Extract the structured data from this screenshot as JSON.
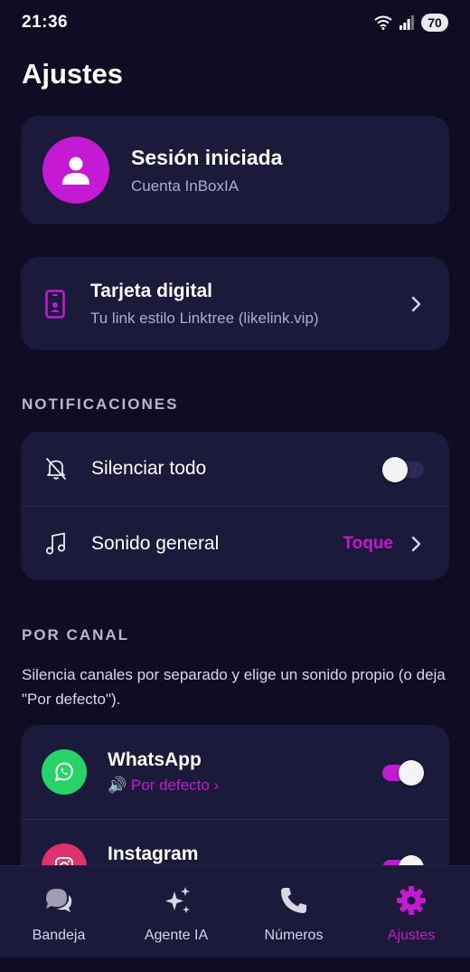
{
  "status_bar": {
    "time": "21:36",
    "battery": "70"
  },
  "page_title": "Ajustes",
  "profile": {
    "title": "Sesión iniciada",
    "subtitle": "Cuenta InBoxIA"
  },
  "digital_card": {
    "title": "Tarjeta digital",
    "subtitle": "Tu link estilo Linktree (likelink.vip)"
  },
  "notifications": {
    "header": "NOTIFICACIONES",
    "mute_all": {
      "label": "Silenciar todo",
      "enabled": false
    },
    "general_sound": {
      "label": "Sonido general",
      "value": "Toque"
    }
  },
  "per_channel": {
    "header": "POR CANAL",
    "description": "Silencia canales por separado y elige un sonido propio (o deja \"Por defecto\").",
    "channels": [
      {
        "name": "WhatsApp",
        "sound": "🔊 Por defecto ›",
        "enabled": true,
        "color": "#25d366",
        "icon": "whatsapp-icon"
      },
      {
        "name": "Instagram",
        "sound": "",
        "enabled": true,
        "color": "#e1306c",
        "icon": "instagram-icon"
      }
    ]
  },
  "bottom_nav": [
    {
      "label": "Bandeja",
      "icon": "chat-bubbles-icon",
      "active": false
    },
    {
      "label": "Agente IA",
      "icon": "sparkles-icon",
      "active": false
    },
    {
      "label": "Números",
      "icon": "phone-icon",
      "active": false
    },
    {
      "label": "Ajustes",
      "icon": "gear-icon",
      "active": true
    }
  ],
  "colors": {
    "background": "#0f0d24",
    "card": "#1b1a3a",
    "accent": "#c51ad3",
    "muted_text": "#aeaec8"
  }
}
